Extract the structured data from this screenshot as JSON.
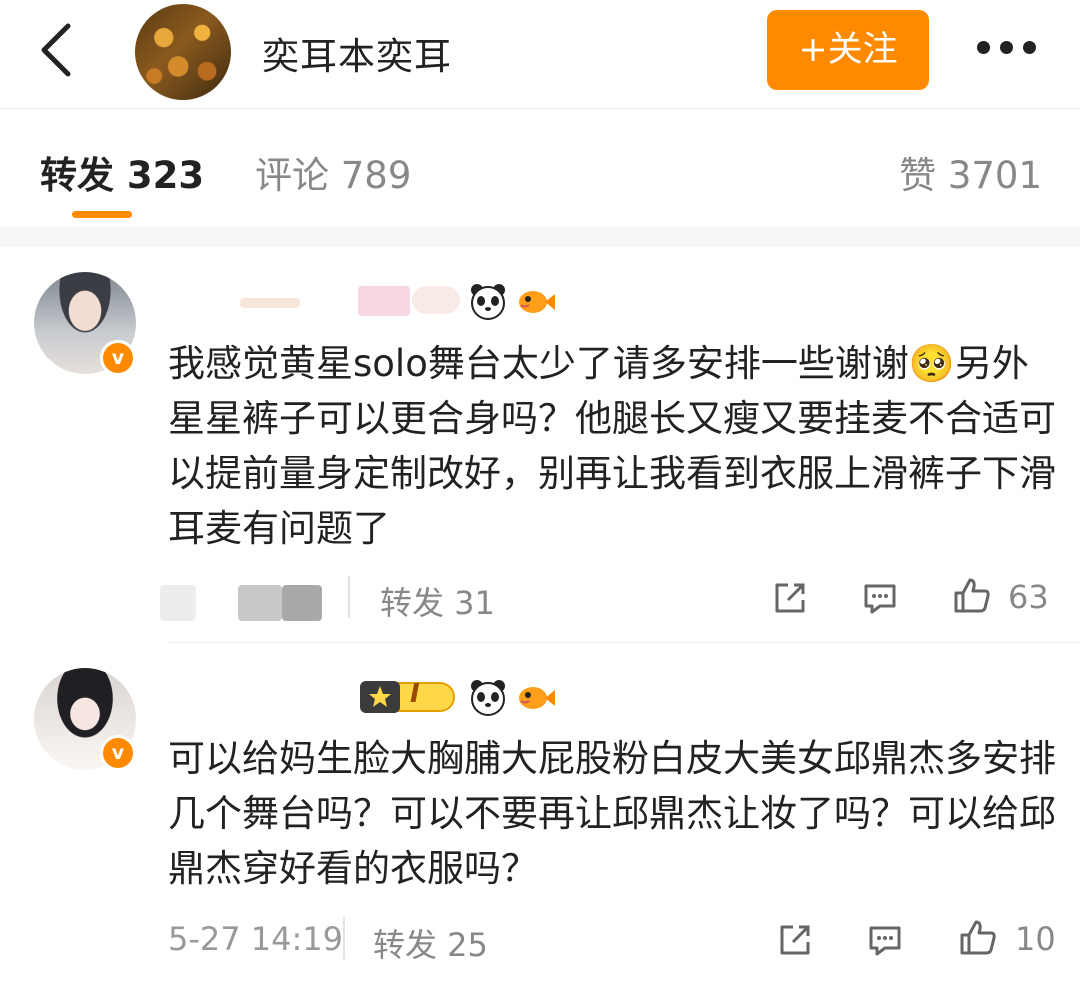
{
  "header": {
    "back_icon": "chevron-left-icon",
    "user_name": "奕耳本奕耳",
    "follow_label": "+关注",
    "more_icon": "more-dots-icon"
  },
  "tabs": {
    "repost": "转发 323",
    "comment": "评论 789",
    "like": "赞 3701"
  },
  "comments": [
    {
      "text": "我感觉黄星solo舞台太少了请多安排一些谢谢🥺另外星星裤子可以更合身吗？他腿长又瘦又要挂麦不合适可以提前量身定制改好，别再让我看到衣服上滑裤子下滑耳麦有问题了",
      "repost_label": "转发 31",
      "like_count": "63"
    },
    {
      "level": "I",
      "text": "可以给妈生脸大胸脯大屁股粉白皮大美女邱鼎杰多安排几个舞台吗？可以不要再让邱鼎杰让妆了吗？可以给邱鼎杰穿好看的衣服吗？",
      "time": "5-27 14:19",
      "repost_label": "转发 25",
      "like_count": "10"
    }
  ],
  "colors": {
    "accent": "#ff8a00",
    "muted": "#888888"
  }
}
